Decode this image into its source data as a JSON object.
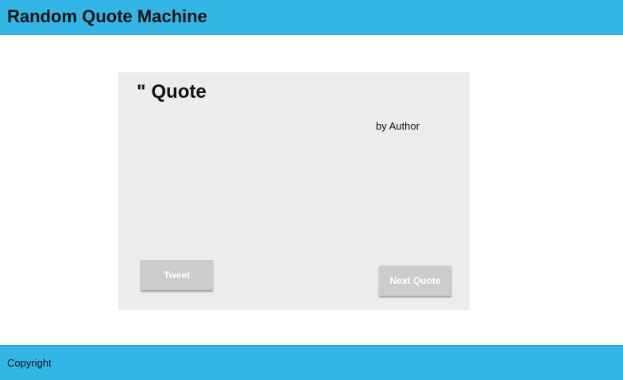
{
  "header": {
    "title": "Random Quote Machine"
  },
  "quote": {
    "mark": "\"",
    "text": "Quote",
    "author_prefix": "by",
    "author": "Author"
  },
  "buttons": {
    "tweet_label": "Tweet",
    "next_label": "Next Quote"
  },
  "footer": {
    "text": "Copyright"
  },
  "colors": {
    "bar": "#33b5e5",
    "card": "#ececec",
    "button": "#cccccc"
  }
}
